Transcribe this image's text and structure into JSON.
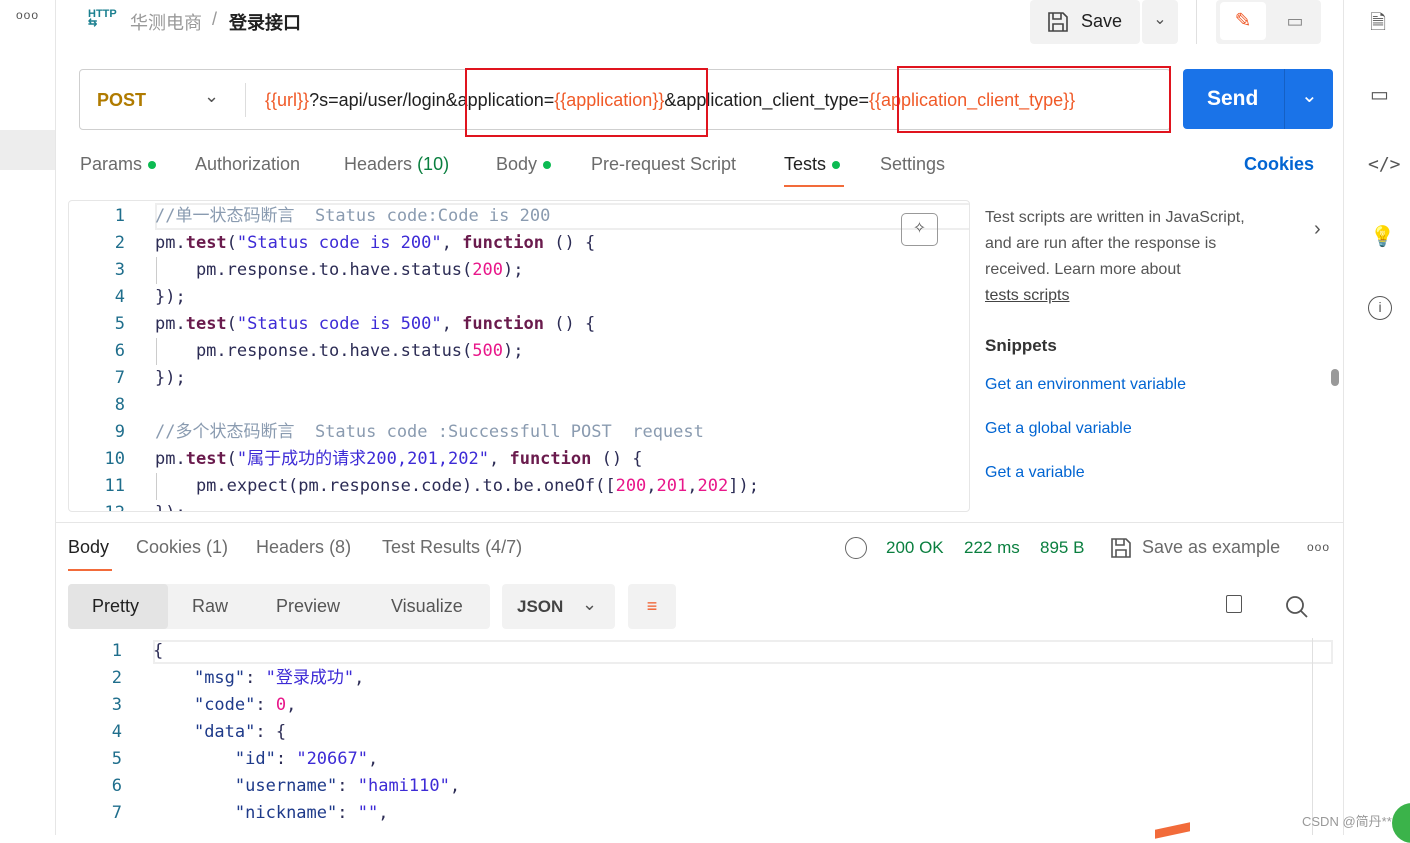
{
  "header": {
    "breadcrumb_parent": "华测电商",
    "separator": "/",
    "title": "登录接口",
    "save_label": "Save"
  },
  "request": {
    "method": "POST",
    "url_parts": [
      {
        "text": "{{url}}",
        "var": true
      },
      {
        "text": "?s=api/user/login&application=",
        "var": false
      },
      {
        "text": "{{application}}",
        "var": true
      },
      {
        "text": "&application_client_type=",
        "var": false
      },
      {
        "text": "{{application_client_type}}",
        "var": true
      }
    ],
    "send_label": "Send"
  },
  "tabs": [
    {
      "label": "Params",
      "dot": true
    },
    {
      "label": "Authorization"
    },
    {
      "label": "Headers",
      "count": "(10)"
    },
    {
      "label": "Body",
      "dot": true
    },
    {
      "label": "Pre-request Script"
    },
    {
      "label": "Tests",
      "dot": true,
      "active": true
    },
    {
      "label": "Settings"
    }
  ],
  "cookies_link": "Cookies",
  "tests_code": [
    [
      [
        "comment",
        "//单一状态码断言  Status code:Code is 200"
      ]
    ],
    [
      [
        "plain",
        "pm."
      ],
      [
        "method",
        "test"
      ],
      [
        "plain",
        "("
      ],
      [
        "str",
        "\"Status code is 200\""
      ],
      [
        "plain",
        ", "
      ],
      [
        "kw",
        "function"
      ],
      [
        "plain",
        " () {"
      ]
    ],
    [
      [
        "plain",
        "    pm.response.to.have.status("
      ],
      [
        "num",
        "200"
      ],
      [
        "plain",
        ");"
      ]
    ],
    [
      [
        "plain",
        "});"
      ]
    ],
    [
      [
        "plain",
        "pm."
      ],
      [
        "method",
        "test"
      ],
      [
        "plain",
        "("
      ],
      [
        "str",
        "\"Status code is 500\""
      ],
      [
        "plain",
        ", "
      ],
      [
        "kw",
        "function"
      ],
      [
        "plain",
        " () {"
      ]
    ],
    [
      [
        "plain",
        "    pm.response.to.have.status("
      ],
      [
        "num",
        "500"
      ],
      [
        "plain",
        ");"
      ]
    ],
    [
      [
        "plain",
        "});"
      ]
    ],
    [
      [
        "plain",
        ""
      ]
    ],
    [
      [
        "comment",
        "//多个状态码断言  Status code :Successfull POST  request"
      ]
    ],
    [
      [
        "plain",
        "pm."
      ],
      [
        "method",
        "test"
      ],
      [
        "plain",
        "("
      ],
      [
        "str",
        "\"属于成功的请求200,201,202\""
      ],
      [
        "plain",
        ", "
      ],
      [
        "kw",
        "function"
      ],
      [
        "plain",
        " () {"
      ]
    ],
    [
      [
        "plain",
        "    pm.expect(pm.response.code).to.be.oneOf(["
      ],
      [
        "num",
        "200"
      ],
      [
        "plain",
        ","
      ],
      [
        "num",
        "201"
      ],
      [
        "plain",
        ","
      ],
      [
        "num",
        "202"
      ],
      [
        "plain",
        "]);"
      ]
    ],
    [
      [
        "plain",
        "});"
      ]
    ]
  ],
  "help": {
    "text_lines": [
      "Test scripts are written in JavaScript,",
      "and are run after the response is",
      "received. Learn more about"
    ],
    "link": "tests scripts",
    "snippets_title": "Snippets",
    "snippets": [
      "Get an environment variable",
      "Get a global variable",
      "Get a variable"
    ]
  },
  "response": {
    "tabs": [
      {
        "label": "Body",
        "active": true
      },
      {
        "label": "Cookies",
        "count": "(1)"
      },
      {
        "label": "Headers",
        "count": "(8)"
      },
      {
        "label": "Test Results",
        "count": "(4/7)"
      }
    ],
    "status": "200 OK",
    "time": "222 ms",
    "size": "895 B",
    "save_example": "Save as example",
    "views": [
      "Pretty",
      "Raw",
      "Preview",
      "Visualize"
    ],
    "active_view": "Pretty",
    "format": "JSON",
    "code": [
      [
        [
          "plain",
          "{"
        ]
      ],
      [
        [
          "plain",
          "    "
        ],
        [
          "key",
          "\"msg\""
        ],
        [
          "plain",
          ": "
        ],
        [
          "str",
          "\"登录成功\""
        ],
        [
          "plain",
          ","
        ]
      ],
      [
        [
          "plain",
          "    "
        ],
        [
          "key",
          "\"code\""
        ],
        [
          "plain",
          ": "
        ],
        [
          "num",
          "0"
        ],
        [
          "plain",
          ","
        ]
      ],
      [
        [
          "plain",
          "    "
        ],
        [
          "key",
          "\"data\""
        ],
        [
          "plain",
          ": {"
        ]
      ],
      [
        [
          "plain",
          "        "
        ],
        [
          "key",
          "\"id\""
        ],
        [
          "plain",
          ": "
        ],
        [
          "str",
          "\"20667\""
        ],
        [
          "plain",
          ","
        ]
      ],
      [
        [
          "plain",
          "        "
        ],
        [
          "key",
          "\"username\""
        ],
        [
          "plain",
          ": "
        ],
        [
          "str",
          "\"hami110\""
        ],
        [
          "plain",
          ","
        ]
      ],
      [
        [
          "plain",
          "        "
        ],
        [
          "key",
          "\"nickname\""
        ],
        [
          "plain",
          ": "
        ],
        [
          "str",
          "\"\""
        ],
        [
          "plain",
          ","
        ]
      ]
    ]
  },
  "watermark": "CSDN @简丹**",
  "colors": {
    "send": "#1a73e8",
    "method": "#b07b00",
    "variable": "#f05a28",
    "active_underline": "#f26b3a",
    "status_green": "#0a7f3f",
    "highlight_box": "#e0141e"
  }
}
